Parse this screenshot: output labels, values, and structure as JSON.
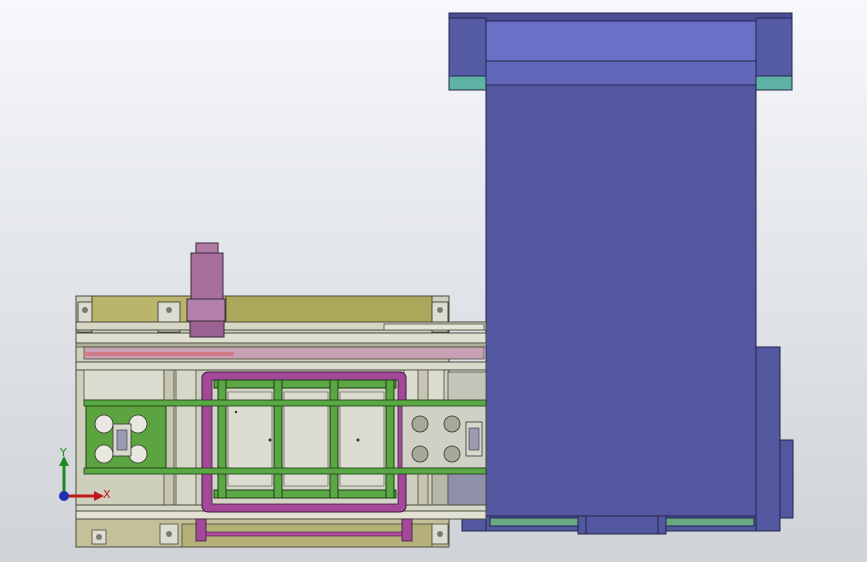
{
  "viewport": {
    "background_top": "#f7f8fb",
    "background_bottom": "#cfd3d8"
  },
  "colors": {
    "hopper_dark": "#555aa0",
    "hopper_light": "#6a70c8",
    "teal": "#5fb2a6",
    "frame": "#c8c8b0",
    "frame_edge": "#5a5a4a",
    "olive": "#b8b46a",
    "green": "#5aa844",
    "magenta": "#b04aa0",
    "plate": "#d0d0c4"
  },
  "triad": {
    "y_label": "Y",
    "x_label": "X",
    "icon": "coordinate-triad-icon"
  }
}
